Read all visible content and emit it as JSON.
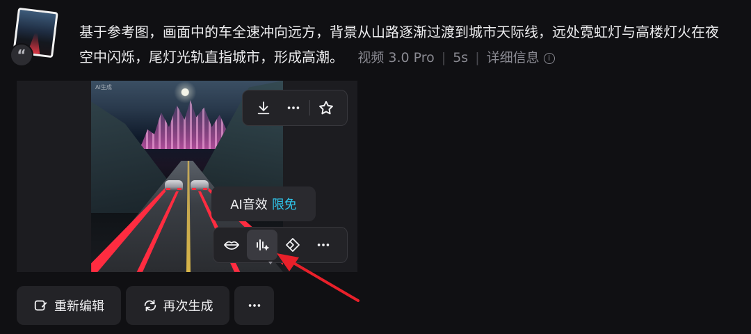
{
  "reference": {
    "quote_glyph": "“"
  },
  "prompt": {
    "text": "基于参考图，画面中的车全速冲向远方，背景从山路逐渐过渡到城市天际线，远处霓虹灯与高楼灯火在夜空中闪烁，尾灯光轨直指城市，形成高潮。",
    "model": "视频 3.0 Pro",
    "duration": "5s",
    "details_label": "详细信息",
    "info_glyph": "i"
  },
  "video": {
    "watermark": "AI生成"
  },
  "toolbar_top": {
    "items": [
      "download-icon",
      "more-icon",
      "star-icon"
    ]
  },
  "toolbar_bottom": {
    "items": [
      "lip-sync-icon",
      "ai-sound-icon",
      "extend-icon",
      "more-icon"
    ],
    "active_index": 1
  },
  "tooltip": {
    "label": "AI音效",
    "badge": "限免",
    "badge_color": "#2fc3e8"
  },
  "annotation": {
    "color": "#e8202a"
  },
  "actions": {
    "edit_label": "重新编辑",
    "regenerate_label": "再次生成",
    "more_glyph": "•••"
  }
}
